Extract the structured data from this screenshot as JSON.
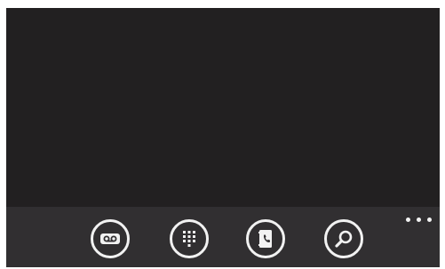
{
  "app_bar": {
    "buttons": [
      {
        "name": "voicemail-button",
        "icon": "voicemail-icon"
      },
      {
        "name": "keypad-button",
        "icon": "keypad-icon"
      },
      {
        "name": "phonebook-button",
        "icon": "phonebook-icon"
      },
      {
        "name": "search-button",
        "icon": "search-icon"
      }
    ],
    "more_icon": "more-options-icon"
  },
  "colors": {
    "content_bg": "#222021",
    "app_bar_bg": "#312f31",
    "icon_fg": "#f2f2f2"
  }
}
